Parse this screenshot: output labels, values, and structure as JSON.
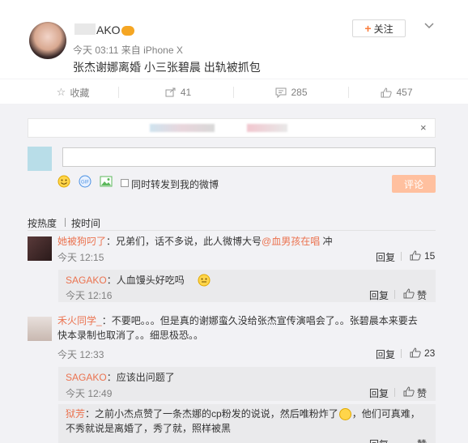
{
  "post": {
    "author_name": "AKO",
    "time": "今天 03:11 来自 iPhone X",
    "content": "张杰谢娜离婚 小三张碧晨 出轨被抓包",
    "follow_label": "关注"
  },
  "actions": {
    "favorite": "收藏",
    "repost": "41",
    "comment": "285",
    "like": "457"
  },
  "composer": {
    "sync_label": "同时转发到我的微博",
    "submit_label": "评论",
    "close": "×"
  },
  "sort": {
    "by_hot": "按热度",
    "by_time": "按时间"
  },
  "comments": [
    {
      "user": "她被狗叼了",
      "text_before": "：兄弟们，话不多说，此人微博大号",
      "mention": "@血男孩在唱",
      "text_after": " 冲",
      "time": "今天 12:15",
      "reply_label": "回复",
      "likes": "15",
      "replies": [
        {
          "user": "SAGAKO",
          "text": "：人血馒头好吃吗",
          "time": "今天 12:16",
          "reply_label": "回复",
          "likes": "赞"
        }
      ]
    },
    {
      "user": "禾火同学_",
      "text_line1": "：不要吧。。。但是真的谢娜蛮久没给张杰宣传演唱会了。。张碧晨本来要去",
      "text_line2": "快本录制也取消了。。细思极恐。。",
      "time": "今天 12:33",
      "reply_label": "回复",
      "likes": "23",
      "replies": [
        {
          "user": "SAGAKO",
          "text": "：应该出问题了",
          "time": "今天 12:49",
          "reply_label": "回复",
          "likes": "赞"
        },
        {
          "user": "狱芳",
          "text_line1": "：之前小杰点赞了一条杰娜的cp粉发的说说，然后唯粉炸了",
          "text_line1b": "，他们可真难，",
          "text_line2": "不秀就说是离婚了，秀了就，照样被黑",
          "reply_label": "回复",
          "likes": "赞"
        }
      ]
    }
  ]
}
